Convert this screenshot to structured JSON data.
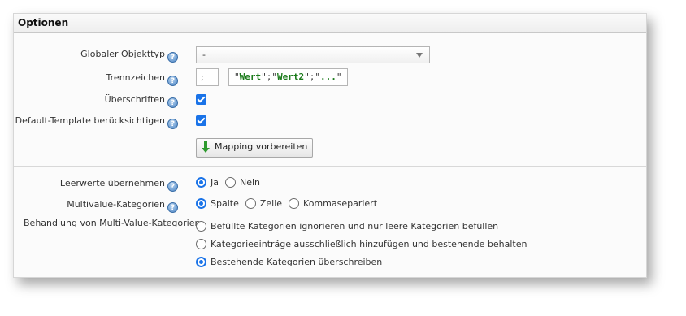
{
  "panel": {
    "title": "Optionen"
  },
  "fields": {
    "object_type": {
      "label": "Globaler Objekttyp",
      "value": "-"
    },
    "separator": {
      "label": "Trennzeichen",
      "value": ";",
      "example_prefix": "\"",
      "example_v1": "Wert",
      "example_mid1": "\";\"",
      "example_v2": "Wert2",
      "example_mid2": "\";\"",
      "example_v3": "...",
      "example_suffix": "\""
    },
    "headers": {
      "label": "Überschriften",
      "checked": true
    },
    "default_template": {
      "label": "Default-Template berücksichtigen",
      "checked": true
    },
    "mapping_button": {
      "label": "Mapping vorbereiten"
    },
    "empty_values": {
      "label": "Leerwerte übernehmen",
      "options": [
        "Ja",
        "Nein"
      ],
      "selected": "Ja"
    },
    "multivalue": {
      "label": "Multivalue-Kategorien",
      "options": [
        "Spalte",
        "Zeile",
        "Kommasepariert"
      ],
      "selected": "Spalte"
    },
    "multivalue_handling": {
      "label": "Behandlung von Multi-Value-Kategorien",
      "options": [
        "Befüllte Kategorien ignorieren und nur leere Kategorien befüllen",
        "Kategorieeinträge ausschließlich hinzufügen und bestehende behalten",
        "Bestehende Kategorien überschreiben"
      ],
      "selected": "Bestehende Kategorien überschreiben"
    }
  },
  "colors": {
    "accent": "#1a73e8",
    "help_icon": "#4a83c4",
    "example_string": "#1a7a1a",
    "button_arrow": "#2e9a2e"
  },
  "icons": {
    "help": "help-icon",
    "button": "green-down-arrow-icon",
    "dropdown": "chevron-down-icon"
  }
}
